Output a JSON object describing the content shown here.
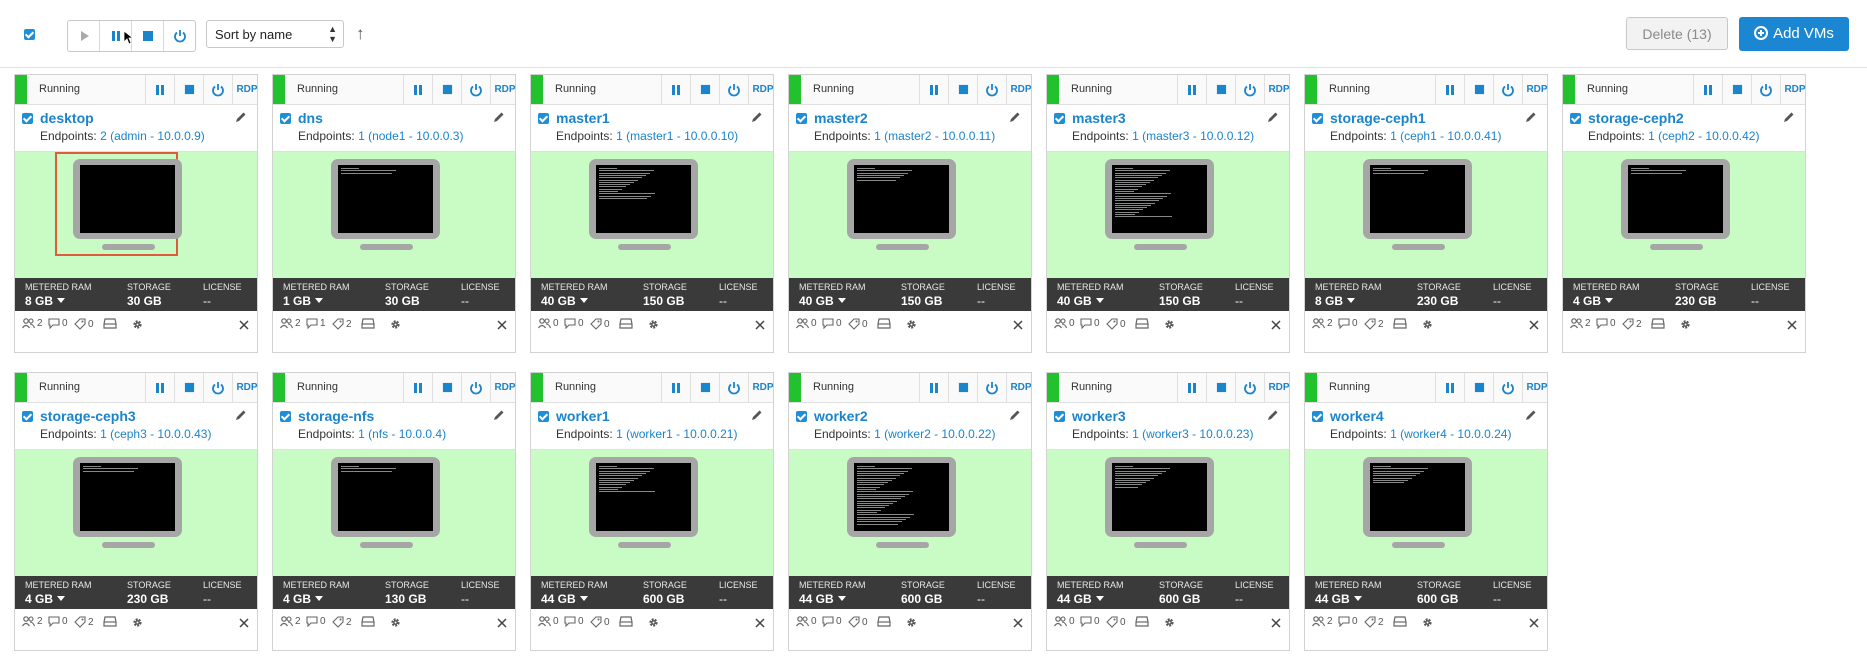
{
  "toolbar": {
    "sort_value": "Sort by name",
    "delete_label": "Delete (13)",
    "add_label": "Add VMs",
    "buttons": [
      "play-icon",
      "pause-icon",
      "stop-icon",
      "power-icon"
    ]
  },
  "card_labels": {
    "endpoints": "Endpoints:",
    "metered_ram": "METERED RAM",
    "storage": "STORAGE",
    "license": "LICENSE",
    "rdp": "RDP"
  },
  "colors": {
    "running": "#22c22e",
    "accent": "#1a84cc",
    "screen_bg": "#c9fcc4",
    "stats_bg": "#3a3a3a",
    "selection": "#e05a3c"
  },
  "vms": [
    {
      "state": "Running",
      "name": "desktop",
      "endpoints": "2 (admin - 10.0.0.9)",
      "ram": "8 GB",
      "storage": "30 GB",
      "license": "--",
      "f1": "2",
      "f2": "0",
      "f3": "0",
      "text_lines": 0,
      "selected": true
    },
    {
      "state": "Running",
      "name": "dns",
      "endpoints": "1 (node1 - 10.0.0.3)",
      "ram": "1 GB",
      "storage": "30 GB",
      "license": "--",
      "f1": "2",
      "f2": "1",
      "f3": "2",
      "text_lines": 3
    },
    {
      "state": "Running",
      "name": "master1",
      "endpoints": "1 (master1 - 10.0.0.10)",
      "ram": "40 GB",
      "storage": "150 GB",
      "license": "--",
      "f1": "0",
      "f2": "0",
      "f3": "0",
      "text_lines": 14
    },
    {
      "state": "Running",
      "name": "master2",
      "endpoints": "1 (master2 - 10.0.0.11)",
      "ram": "40 GB",
      "storage": "150 GB",
      "license": "--",
      "f1": "0",
      "f2": "0",
      "f3": "0",
      "text_lines": 6
    },
    {
      "state": "Running",
      "name": "master3",
      "endpoints": "1 (master3 - 10.0.0.12)",
      "ram": "40 GB",
      "storage": "150 GB",
      "license": "--",
      "f1": "0",
      "f2": "0",
      "f3": "0",
      "text_lines": 22
    },
    {
      "state": "Running",
      "name": "storage-ceph1",
      "endpoints": "1 (ceph1 - 10.0.0.41)",
      "ram": "8 GB",
      "storage": "230 GB",
      "license": "--",
      "f1": "2",
      "f2": "0",
      "f3": "2",
      "text_lines": 3
    },
    {
      "state": "Running",
      "name": "storage-ceph2",
      "endpoints": "1 (ceph2 - 10.0.0.42)",
      "ram": "4 GB",
      "storage": "230 GB",
      "license": "--",
      "f1": "2",
      "f2": "0",
      "f3": "2",
      "text_lines": 3
    },
    {
      "state": "Running",
      "name": "storage-ceph3",
      "endpoints": "1 (ceph3 - 10.0.0.43)",
      "ram": "4 GB",
      "storage": "230 GB",
      "license": "--",
      "f1": "2",
      "f2": "0",
      "f3": "2",
      "text_lines": 3
    },
    {
      "state": "Running",
      "name": "storage-nfs",
      "endpoints": "1 (nfs - 10.0.0.4)",
      "ram": "4 GB",
      "storage": "130 GB",
      "license": "--",
      "f1": "2",
      "f2": "0",
      "f3": "2",
      "text_lines": 3
    },
    {
      "state": "Running",
      "name": "worker1",
      "endpoints": "1 (worker1 - 10.0.0.21)",
      "ram": "44 GB",
      "storage": "600 GB",
      "license": "--",
      "f1": "0",
      "f2": "0",
      "f3": "0",
      "text_lines": 12
    },
    {
      "state": "Running",
      "name": "worker2",
      "endpoints": "1 (worker2 - 10.0.0.22)",
      "ram": "44 GB",
      "storage": "600 GB",
      "license": "--",
      "f1": "0",
      "f2": "0",
      "f3": "0",
      "text_lines": 26
    },
    {
      "state": "Running",
      "name": "worker3",
      "endpoints": "1 (worker3 - 10.0.0.23)",
      "ram": "44 GB",
      "storage": "600 GB",
      "license": "--",
      "f1": "0",
      "f2": "0",
      "f3": "0",
      "text_lines": 10
    },
    {
      "state": "Running",
      "name": "worker4",
      "endpoints": "1 (worker4 - 10.0.0.24)",
      "ram": "44 GB",
      "storage": "600 GB",
      "license": "--",
      "f1": "2",
      "f2": "0",
      "f3": "2",
      "text_lines": 8
    }
  ]
}
